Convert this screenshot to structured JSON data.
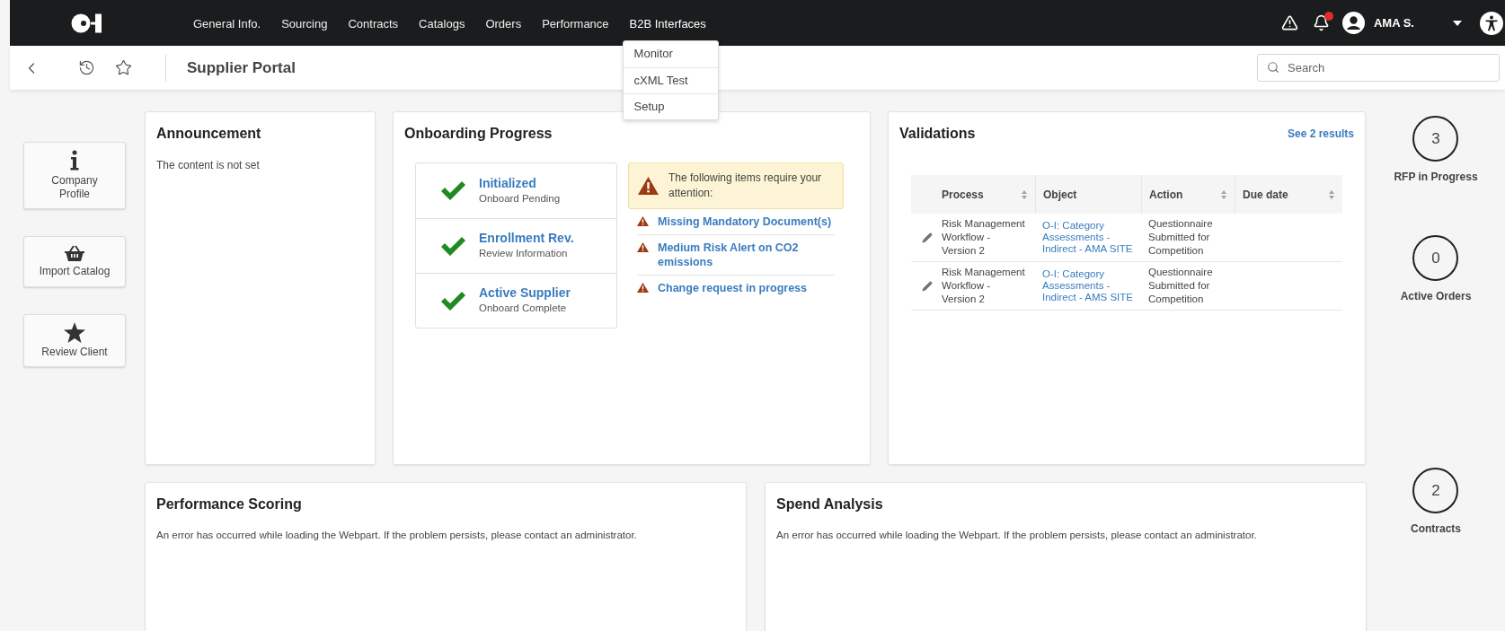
{
  "nav": {
    "items": [
      {
        "label": "General Info."
      },
      {
        "label": "Sourcing"
      },
      {
        "label": "Contracts"
      },
      {
        "label": "Catalogs"
      },
      {
        "label": "Orders"
      },
      {
        "label": "Performance"
      },
      {
        "label": "B2B Interfaces",
        "expanded": true
      }
    ],
    "menu": [
      "Monitor",
      "cXML Test",
      "Setup"
    ],
    "notifications": {
      "unread": true
    },
    "user": "AMA S."
  },
  "header": {
    "title": "Supplier Portal",
    "search": {
      "placeholder": "Search"
    }
  },
  "quick_actions": [
    {
      "kind": "info",
      "label": "Company Profile"
    },
    {
      "kind": "basket",
      "label": "Import Catalog"
    },
    {
      "kind": "star",
      "label": "Review Client"
    }
  ],
  "announcement": {
    "title": "Announcement",
    "text": "The content is not set"
  },
  "onboarding": {
    "title": "Onboarding Progress",
    "steps": [
      {
        "title": "Initialized",
        "status": "Onboard Pending",
        "done": true
      },
      {
        "title": "Enrollment Rev.",
        "status": "Review Information",
        "done": true
      },
      {
        "title": "Active Supplier",
        "status": "Onboard Complete",
        "done": true
      }
    ],
    "notice": "The following items require your attention:",
    "alerts": [
      "Missing Mandatory Document(s)",
      "Medium Risk Alert on CO2 emissions",
      "Change request in progress"
    ]
  },
  "validations": {
    "title": "Validations",
    "link": "See 2 results",
    "columns": [
      {
        "label": "Process",
        "sortable": true
      },
      {
        "label": "Object",
        "sortable": false
      },
      {
        "label": "Action",
        "sortable": true
      },
      {
        "label": "Due date",
        "sortable": true
      }
    ],
    "rows": [
      {
        "process": "Risk Management Workflow - Version 2",
        "object": "O-I: Category Assessments - Indirect - AMA SITE",
        "action": "Questionnaire Submitted for Competition"
      },
      {
        "process": "Risk Management Workflow - Version 2",
        "object": "O-I: Category Assessments - Indirect - AMS SITE",
        "action": "Questionnaire Submitted for Competition"
      }
    ]
  },
  "bottom_cards": [
    {
      "title": "Performance Scoring",
      "text": "An error has occurred while loading the Webpart. If the problem persists, please contact an administrator."
    },
    {
      "title": "Spend Analysis",
      "text": "An error has occurred while loading the Webpart. If the problem persists, please contact an administrator."
    }
  ],
  "stats": [
    {
      "value": "3",
      "label": "RFP in Progress"
    },
    {
      "value": "0",
      "label": "Active Orders"
    },
    {
      "value": "2",
      "label": "Contracts"
    }
  ]
}
